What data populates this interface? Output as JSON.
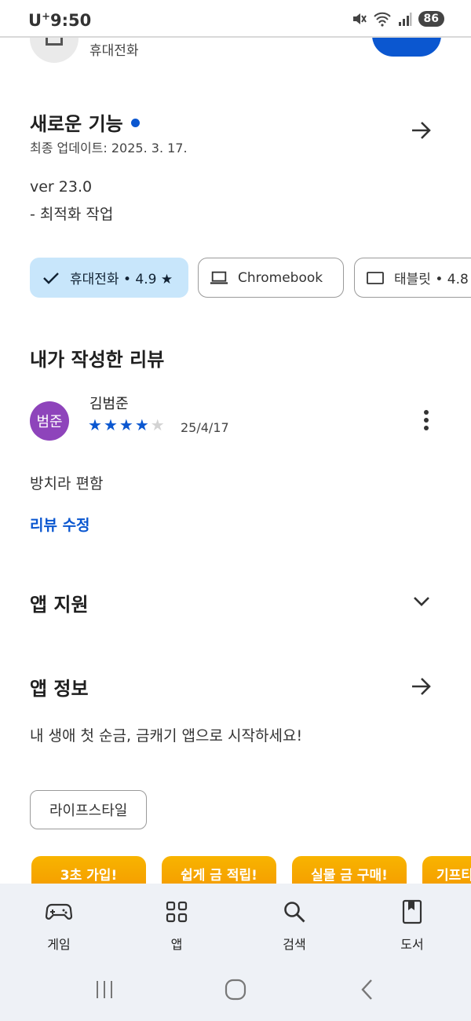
{
  "status_bar": {
    "carrier": "U",
    "carrier_sup": "+",
    "time": "9:50",
    "battery": "86"
  },
  "header": {
    "device_label": "휴대전화"
  },
  "whats_new": {
    "title": "새로운 기능",
    "updated": "최종 업데이트: 2025. 3. 17.",
    "version": "ver 23.0",
    "note": "- 최적화 작업"
  },
  "device_chips": [
    {
      "label": "휴대전화 • 4.9 ★",
      "selected": true,
      "icon": "check-icon"
    },
    {
      "label": "Chromebook",
      "selected": false,
      "icon": "laptop-icon"
    },
    {
      "label": "태블릿 • 4.8 ★",
      "selected": false,
      "icon": "tablet-icon"
    }
  ],
  "my_review": {
    "title": "내가 작성한 리뷰",
    "avatar_text": "범준",
    "reviewer": "김범준",
    "rating": 4,
    "max_rating": 5,
    "date": "25/4/17",
    "text": "방치라 편함",
    "edit_link": "리뷰 수정"
  },
  "app_support": {
    "title": "앱 지원"
  },
  "app_info": {
    "title": "앱 정보",
    "description": "내 생애 첫 순금, 금캐기 앱으로 시작하세요!",
    "tag": "라이프스타일"
  },
  "banners": [
    "3초 가입!",
    "쉽게 금 적립!",
    "실물 금 구매!",
    "기프티"
  ],
  "bottom_nav": [
    {
      "label": "게임",
      "icon": "gamepad-icon"
    },
    {
      "label": "앱",
      "icon": "apps-grid-icon"
    },
    {
      "label": "검색",
      "icon": "search-icon"
    },
    {
      "label": "도서",
      "icon": "book-icon"
    }
  ],
  "colors": {
    "accent": "#0b57d0",
    "chip_selected": "#c8e6fb",
    "avatar": "#8e44bb",
    "banner": "#f8b400",
    "nav_bg": "#eef1f6"
  }
}
